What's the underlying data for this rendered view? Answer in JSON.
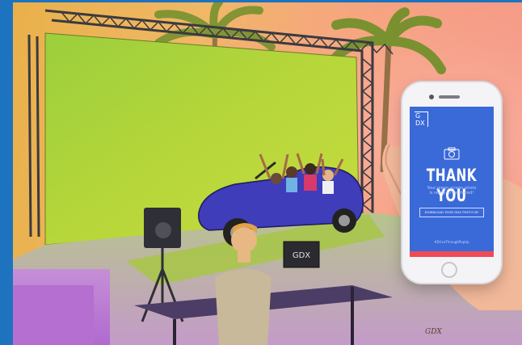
{
  "scene": {
    "monitor_label": "GDX",
    "artist_signature": "GDX"
  },
  "phone": {
    "logo_line1": "G",
    "logo_line2": "DX",
    "title": "THANK YOU",
    "subtitle_line1": "Your green screen photo",
    "subtitle_line2": "is ready to be shared!",
    "download_button": "DOWNLOAD YOUR GDX PHOTO BY",
    "hashtag": "#DriveThroughPopUp",
    "accent_color": "#3a69d8",
    "bar_color": "#ee4b55",
    "camera_icon": "camera-icon"
  }
}
